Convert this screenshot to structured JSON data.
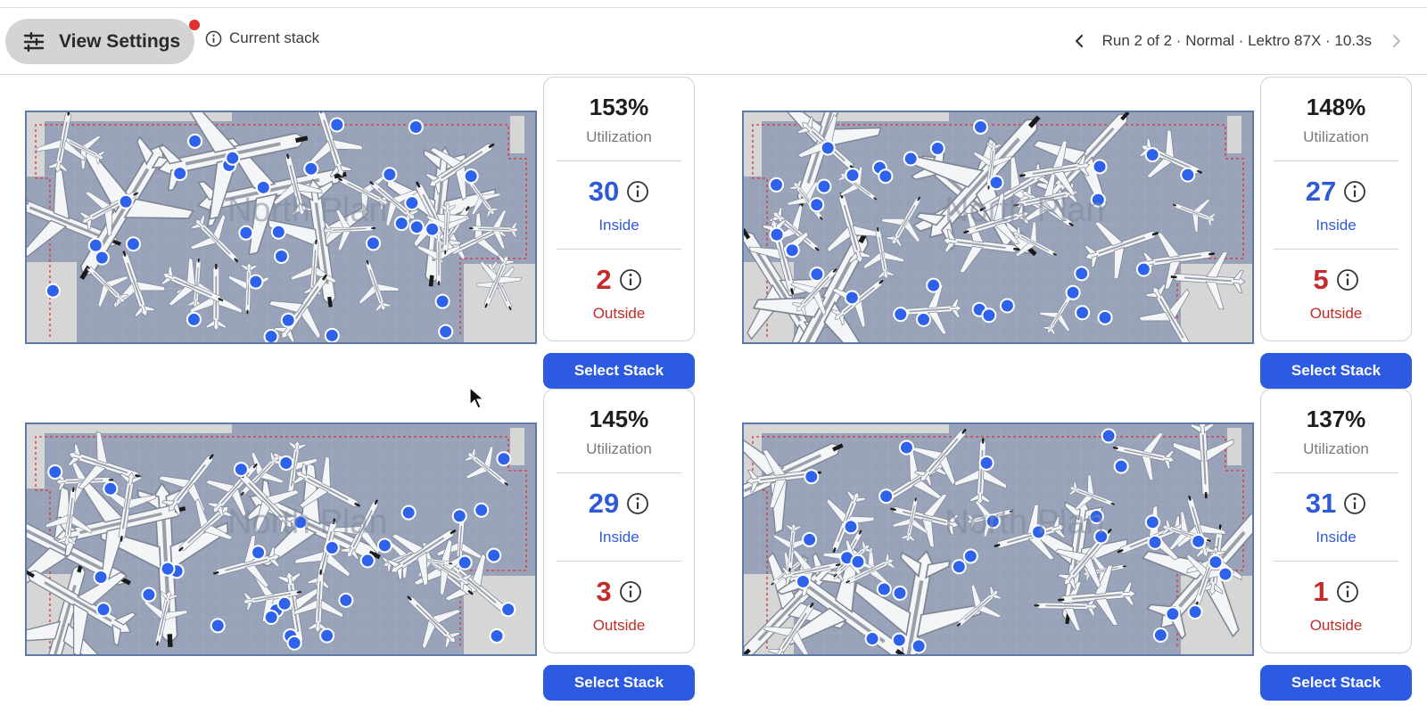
{
  "toolbar": {
    "view_settings_label": "View Settings",
    "current_stack_label": "Current stack",
    "run_label": "Run 2 of 2 · Normal · Lektro 87X · 10.3s",
    "has_notification": true
  },
  "colors": {
    "accent": "#2c5ae0",
    "inside": "#2f5ad6",
    "outside": "#c42b2b",
    "notification": "#e03131",
    "map_floor": "#98a2b8"
  },
  "stacks": [
    {
      "utilization": "153%",
      "utilization_label": "Utilization",
      "inside": "30",
      "inside_label": "Inside",
      "outside": "2",
      "outside_label": "Outside",
      "button_label": "Select Stack",
      "map_watermark": "North Plan"
    },
    {
      "utilization": "148%",
      "utilization_label": "Utilization",
      "inside": "27",
      "inside_label": "Inside",
      "outside": "5",
      "outside_label": "Outside",
      "button_label": "Select Stack",
      "map_watermark": "North Plan"
    },
    {
      "utilization": "145%",
      "utilization_label": "Utilization",
      "inside": "29",
      "inside_label": "Inside",
      "outside": "3",
      "outside_label": "Outside",
      "button_label": "Select Stack",
      "map_watermark": "North Plan"
    },
    {
      "utilization": "137%",
      "utilization_label": "Utilization",
      "inside": "31",
      "inside_label": "Inside",
      "outside": "1",
      "outside_label": "Outside",
      "button_label": "Select Stack",
      "map_watermark": "North Plan"
    }
  ]
}
